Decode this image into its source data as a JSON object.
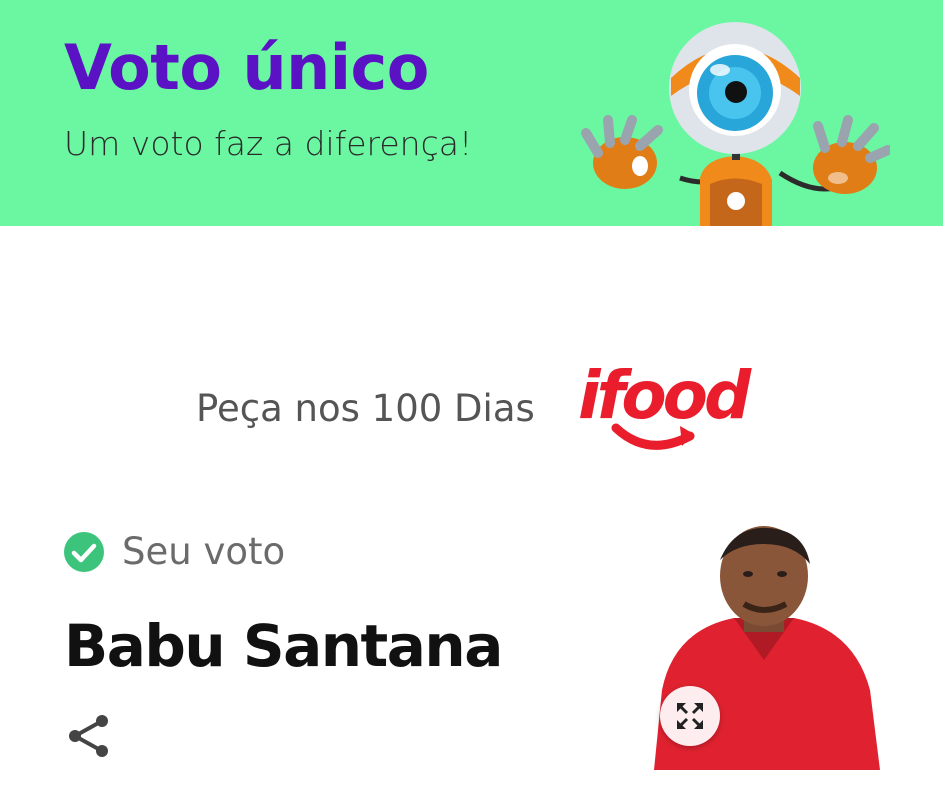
{
  "banner": {
    "title": "Voto único",
    "subtitle": "Um voto faz a diferença!",
    "background_color": "#6bf7a2",
    "title_color": "#5a12c4"
  },
  "sponsor": {
    "text": "Peça nos 100 Dias",
    "logo_text": "ifood",
    "logo_color": "#ea1d2c"
  },
  "vote": {
    "label": "Seu voto",
    "candidate": "Babu Santana",
    "check_color": "#3cc47c"
  },
  "icons": {
    "check": "check-circle-icon",
    "share": "share-icon",
    "expand": "expand-icon"
  }
}
